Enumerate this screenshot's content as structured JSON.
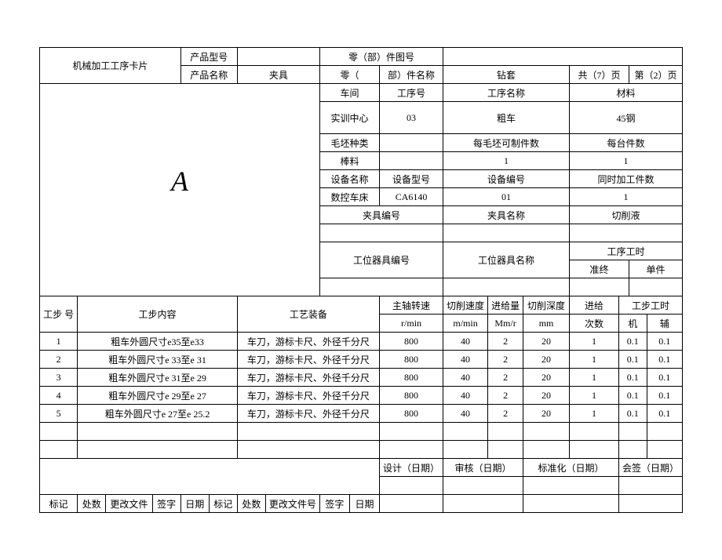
{
  "header": {
    "title": "机械加工工序卡片",
    "productModelLabel": "产品型号",
    "productNameLabel": "产品名称",
    "fixture": "夹具",
    "partDrawingNoLabel": "零（部）件图号",
    "partNameLabelLeft": "零（",
    "partNameLabelRight": "部）件名称",
    "drillSleeve": "钻套",
    "totalPages": "共（7）页",
    "currentPage": "第（2）页"
  },
  "info": {
    "workshopLabel": "车间",
    "processNoLabel": "工序号",
    "processNameLabel": "工序名称",
    "materialLabel": "材料",
    "workshop": "实训中心",
    "processNo": "03",
    "processName": "粗车",
    "material": "45钢",
    "blankTypeLabel": "毛坯种类",
    "blankPartsLabel": "每毛坯可制件数",
    "partsPerUnitLabel": "每台件数",
    "blankType": "棒料",
    "blankParts": "1",
    "partsPerUnit": "1",
    "equipNameLabel": "设备名称",
    "equipModelLabel": "设备型号",
    "equipNoLabel": "设备编号",
    "simultaneousLabel": "同时加工件数",
    "equipName": "数控车床",
    "equipModel": "CA6140",
    "equipNo": "01",
    "simultaneous": "1",
    "fixtureNoLabel": "夹具编号",
    "fixtureNameLabel": "夹具名称",
    "coolantLabel": "切削液",
    "toolNoLabel": "工位器具编号",
    "toolNameLabel": "工位器具名称",
    "processTimeLabel": "工序工时",
    "prepLabel": "准终",
    "unitLabel": "单件"
  },
  "italicA": "A",
  "cols": {
    "stepNo": "工步 号",
    "content": "工步内容",
    "tooling": "工艺装备",
    "spindleSpeed": "主轴转速",
    "spindleUnit": "r/min",
    "cutSpeed": "切削速度",
    "cutSpeedUnit": "m/min",
    "feed": "进给量",
    "feedUnit": "Mm/r",
    "depth": "切削深度",
    "depthUnit": "mm",
    "passes": "进给",
    "passesUnit": "次数",
    "stepTime": "工步工时",
    "machine": "机",
    "aux": "辅"
  },
  "steps": [
    {
      "no": "1",
      "content": "粗车外圆尺寸e35至e33",
      "tooling": "车刀，游标卡尺、外径千分尺",
      "speed": "800",
      "cut": "40",
      "feed": "2",
      "depth": "20",
      "pass": "1",
      "m": "0.1",
      "a": "0.1"
    },
    {
      "no": "2",
      "content": "粗车外圆尺寸e 33至e 31",
      "tooling": "车刀，游标卡尺、外径千分尺",
      "speed": "800",
      "cut": "40",
      "feed": "2",
      "depth": "20",
      "pass": "1",
      "m": "0.1",
      "a": "0.1"
    },
    {
      "no": "3",
      "content": "粗车外圆尺寸e 31至e 29",
      "tooling": "车刀，游标卡尺、外径千分尺",
      "speed": "800",
      "cut": "40",
      "feed": "2",
      "depth": "20",
      "pass": "1",
      "m": "0.1",
      "a": "0.1"
    },
    {
      "no": "4",
      "content": "粗车外圆尺寸e 29至e 27",
      "tooling": "车刀，游标卡尺、外径千分尺",
      "speed": "800",
      "cut": "40",
      "feed": "2",
      "depth": "20",
      "pass": "1",
      "m": "0.1",
      "a": "0.1"
    },
    {
      "no": "5",
      "content": "粗车外圆尺寸e 27至e 25.2",
      "tooling": "车刀，游标卡尺、外径千分尺",
      "speed": "800",
      "cut": "40",
      "feed": "2",
      "depth": "20",
      "pass": "1",
      "m": "0.1",
      "a": "0.1"
    }
  ],
  "footer": {
    "design": "设计（日期）",
    "audit": "审核（日期）",
    "standard": "标准化（日期）",
    "cosign": "会签（日期）",
    "mark": "标记",
    "places": "处数",
    "changeDoc": "更改文件",
    "sign": "签字",
    "date": "日期",
    "mark2": "标记",
    "places2": "处数",
    "changeDoc2": "更改文件号",
    "sign2": "签字",
    "date2": "日期"
  }
}
